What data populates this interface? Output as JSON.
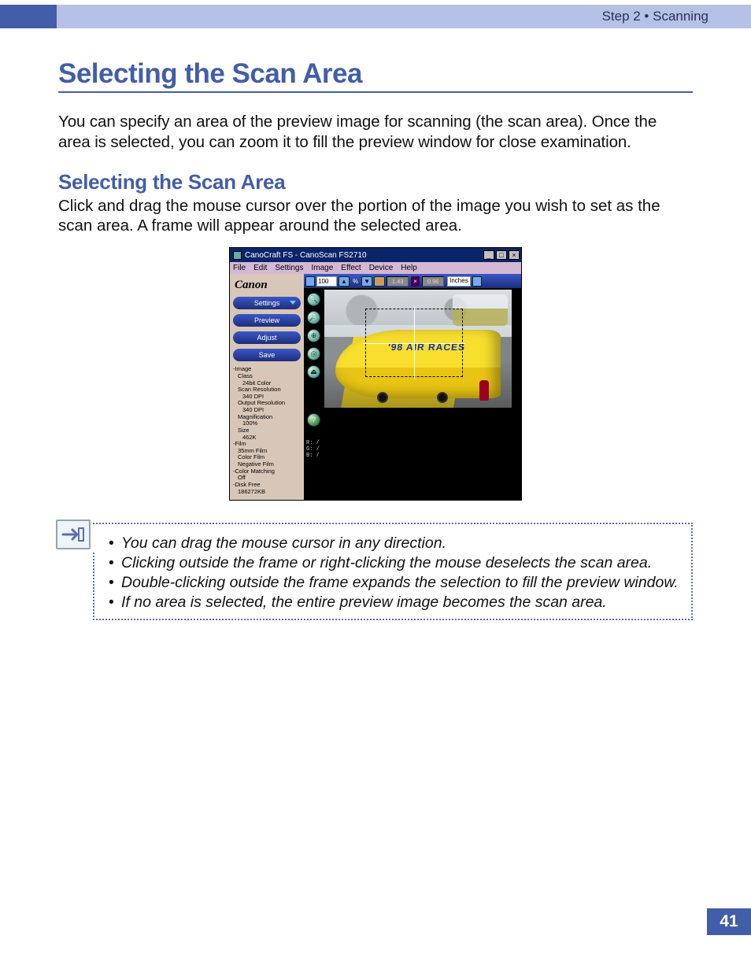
{
  "header": {
    "breadcrumb": "Step 2 • Scanning"
  },
  "title_main": "Selecting the Scan Area",
  "intro": "You can specify an area of the preview image for scanning (the scan area). Once the area is selected, you can zoom it to fill the preview window for close examination.",
  "title_sub": "Selecting the Scan Area",
  "sub_text": "Click and drag the mouse cursor over the portion of the image you wish to set as the scan area. A frame will appear around the selected area.",
  "figure": {
    "window_title": "CanoCraft FS - CanoScan FS2710",
    "window_buttons": [
      "_",
      "□",
      "×"
    ],
    "menus": [
      "File",
      "Edit",
      "Settings",
      "Image",
      "Effect",
      "Device",
      "Help"
    ],
    "brand": "Canon",
    "side_buttons": [
      "Settings",
      "Preview",
      "Adjust",
      "Save"
    ],
    "zoom_value": "100",
    "percent_symbol": "%",
    "dim_w": "1.43",
    "dim_h": "0.96",
    "dim_x": "×",
    "units_label": "Inches",
    "rgb": {
      "r": "R:    /",
      "g": "G:    /",
      "b": "B:    /"
    },
    "banner_text": "'98 AIR RACES",
    "info": {
      "hd_image": "-Image",
      "class_label": "Class",
      "class_value": "24bit Color",
      "scanres_label": "Scan Resolution",
      "scanres_value": "340 DPI",
      "outres_label": "Output Resolution",
      "outres_value": "340 DPI",
      "mag_label": "Magnification",
      "mag_value": "100%",
      "size_label": "Size",
      "size_value": "462K",
      "hd_film": "-Film",
      "film1": "35mm Film",
      "film2": "Color Film",
      "film3": "Negative Film",
      "cm_label": "-Color Matching",
      "cm_value": "Off",
      "disk_label": "-Disk Free",
      "disk_value": "186272KB"
    },
    "tool_glyphs": [
      "🔍",
      "🔎",
      "⊕",
      "◎",
      "⏏",
      "?"
    ]
  },
  "notes": [
    "You can drag the mouse cursor in any direction.",
    "Clicking outside the frame or right-clicking the mouse deselects the scan area.",
    "Double-clicking outside the frame expands the selection to fill the preview window.",
    "If no area is selected, the entire preview image becomes the scan area."
  ],
  "page_number": "41"
}
